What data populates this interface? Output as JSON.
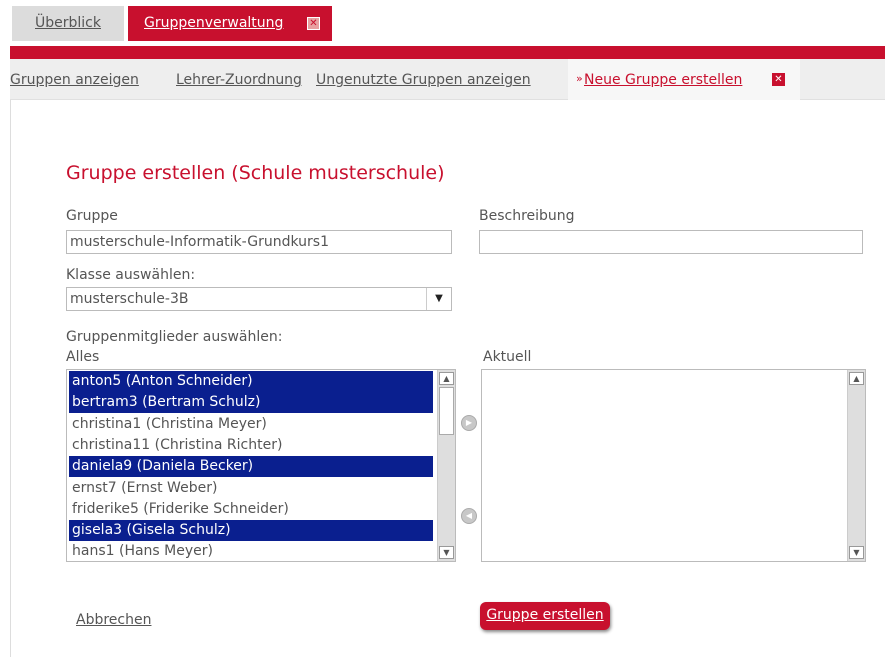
{
  "tabs": [
    {
      "label": "Überblick"
    },
    {
      "label": "Gruppenverwaltung"
    }
  ],
  "submenu": [
    {
      "label": "Gruppen anzeigen"
    },
    {
      "label": "Lehrer-Zuordnung"
    },
    {
      "label": "Ungenutzte Gruppen anzeigen"
    },
    {
      "label": "Neue Gruppe erstellen"
    }
  ],
  "form": {
    "title": "Gruppe erstellen (Schule musterschule)",
    "group_label": "Gruppe",
    "group_value": "musterschule-Informatik-Grundkurs1",
    "description_label": "Beschreibung",
    "description_value": "",
    "class_label": "Klasse auswählen:",
    "class_value": "musterschule-3B",
    "members_label": "Gruppenmitglieder auswählen:",
    "all_label": "Alles",
    "current_label": "Aktuell",
    "all_members": [
      {
        "text": "anton5 (Anton Schneider)",
        "selected": true
      },
      {
        "text": "bertram3 (Bertram Schulz)",
        "selected": true
      },
      {
        "text": "christina1 (Christina Meyer)",
        "selected": false
      },
      {
        "text": "christina11 (Christina Richter)",
        "selected": false
      },
      {
        "text": "daniela9 (Daniela Becker)",
        "selected": true
      },
      {
        "text": "ernst7 (Ernst Weber)",
        "selected": false
      },
      {
        "text": "friderike5 (Friderike Schneider)",
        "selected": false
      },
      {
        "text": "gisela3 (Gisela Schulz)",
        "selected": true
      },
      {
        "text": "hans1 (Hans Meyer)",
        "selected": false
      }
    ],
    "current_members": [],
    "cancel_label": "Abbrechen",
    "submit_label": "Gruppe erstellen"
  },
  "colors": {
    "accent": "#c8102e",
    "selection": "#0a1f8f"
  },
  "icons": {
    "tab_close": "close-icon",
    "submenu_arrow": "double-chevron-right-icon",
    "move_right": "arrow-right-circle-icon",
    "move_left": "arrow-left-circle-icon"
  }
}
